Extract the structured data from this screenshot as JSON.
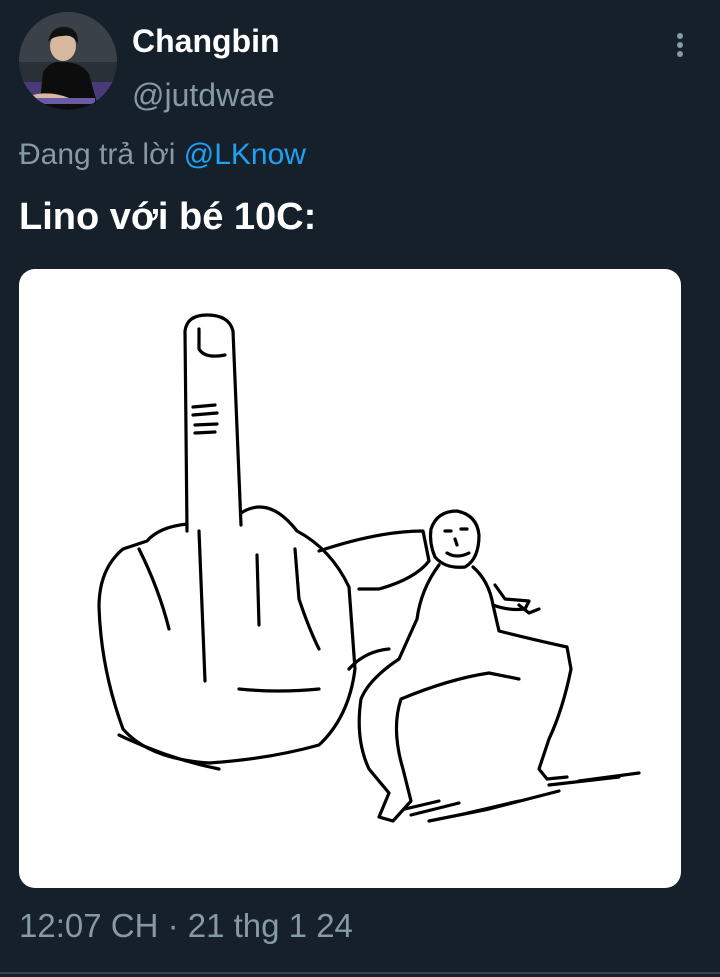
{
  "tweet": {
    "author": {
      "display_name": "Changbin",
      "handle": "@jutdwae",
      "avatar_icon": "profile-photo"
    },
    "more_icon": "vertical-ellipsis-icon",
    "reply_prefix": "Đang trả lời ",
    "reply_mention": "@LKnow",
    "text": "Lino với bé 10C:",
    "media_icon": "line-drawing-meme-image",
    "time": "12:07 CH",
    "separator": " · ",
    "date": "21 thg 1 24"
  },
  "colors": {
    "background": "#15202b",
    "primary_text": "#ffffff",
    "secondary_text": "#8899a6",
    "link": "#1da1f2",
    "divider": "#38444d"
  }
}
